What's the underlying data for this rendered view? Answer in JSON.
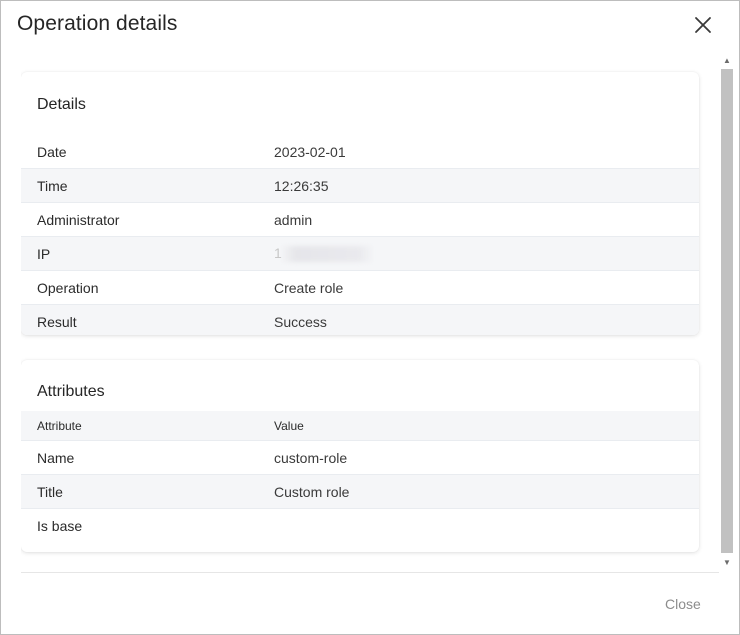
{
  "dialog": {
    "title": "Operation details",
    "close_icon": "close-icon",
    "footer_close_label": "Close"
  },
  "details": {
    "title": "Details",
    "rows": [
      {
        "label": "Date",
        "value": "2023-02-01"
      },
      {
        "label": "Time",
        "value": "12:26:35"
      },
      {
        "label": "Administrator",
        "value": "admin"
      },
      {
        "label": "IP",
        "value": "1"
      },
      {
        "label": "Operation",
        "value": "Create role"
      },
      {
        "label": "Result",
        "value": "Success"
      }
    ]
  },
  "attributes": {
    "title": "Attributes",
    "columns": {
      "attribute": "Attribute",
      "value": "Value"
    },
    "rows": [
      {
        "label": "Name",
        "value": "custom-role"
      },
      {
        "label": "Title",
        "value": "Custom role"
      },
      {
        "label": "Is base",
        "value": ""
      }
    ]
  },
  "colors": {
    "row_alt": "#f5f6f8",
    "scroll_thumb": "#c1c1c1",
    "footer_link": "#8c8c8c"
  }
}
